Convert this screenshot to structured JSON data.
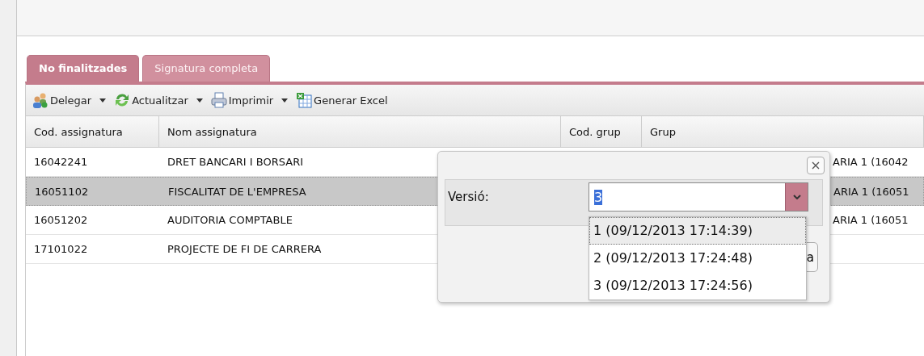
{
  "tabs": [
    {
      "label": "No finalitzades",
      "selected": true
    },
    {
      "label": "Signatura completa",
      "selected": false
    }
  ],
  "toolbar": [
    {
      "kind": "delegate",
      "label": "Delegar",
      "menu": true
    },
    {
      "kind": "refresh",
      "label": "Actualitzar",
      "menu": true
    },
    {
      "kind": "print",
      "label": "Imprimir",
      "menu": true
    },
    {
      "kind": "excel",
      "label": "Generar Excel",
      "menu": false
    }
  ],
  "table": {
    "columns": [
      "Cod. assignatura",
      "Nom assignatura",
      "Cod. grup",
      "Grup"
    ],
    "rows": [
      {
        "code": "16042241",
        "name": "DRET BANCARI I BORSARI",
        "group": "ARIA 1 (16042",
        "selected": false
      },
      {
        "code": "16051102",
        "name": "FISCALITAT DE L'EMPRESA",
        "group": "ARIA 1 (16051",
        "selected": true
      },
      {
        "code": "16051202",
        "name": "AUDITORIA COMPTABLE",
        "group": "ARIA 1 (16051",
        "selected": false
      },
      {
        "code": "17101022",
        "name": "PROJECTE DE FI DE CARRERA",
        "selected": false
      }
    ]
  },
  "dialog": {
    "label": "Versió:",
    "value": "3",
    "button": "a",
    "options": [
      {
        "label": "1 (09/12/2013 17:14:39)",
        "selected": true
      },
      {
        "label": "2 (09/12/2013 17:24:48)",
        "selected": false
      },
      {
        "label": "3 (09/12/2013 17:24:56)",
        "selected": false
      }
    ]
  }
}
